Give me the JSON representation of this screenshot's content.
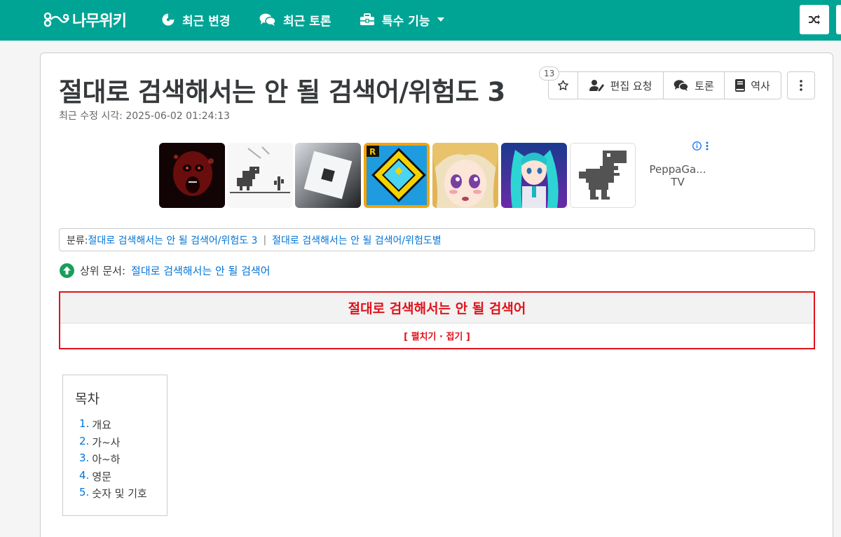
{
  "nav": {
    "logo_text": "나무위키",
    "items": [
      {
        "label": "최근 변경",
        "icon": "compass-icon"
      },
      {
        "label": "최근 토론",
        "icon": "comments-icon"
      },
      {
        "label": "특수 기능",
        "icon": "toolbox-icon"
      }
    ],
    "brand_color": "#00a495"
  },
  "page": {
    "title": "절대로 검색해서는 안 될 검색어/위험도 3",
    "modified": "최근 수정 시각: 2025-06-02 01:24:13",
    "star_count": "13",
    "actions": {
      "edit_request": "편집 요청",
      "discuss": "토론",
      "history": "역사"
    }
  },
  "ad": {
    "label": "PeppaGa... TV",
    "thumbnails": [
      "red-face-thumbnail",
      "dino-game-thumbnail",
      "roblox-logo-thumbnail",
      "geometry-dash-thumbnail",
      "anime-girl-thumbnail",
      "vocaloid-thumbnail",
      "dino-pixel-thumbnail"
    ]
  },
  "category": {
    "label": "분류:",
    "items": [
      "절대로 검색해서는 안 될 검색어/위험도 3",
      "절대로 검색해서는 안 될 검색어/위험도별"
    ]
  },
  "parent_doc": {
    "label": "상위 문서:",
    "link": "절대로 검색해서는 안 될 검색어"
  },
  "navbox": {
    "title": "절대로 검색해서는 안 될 검색어",
    "toggle": "[ 펼치기 · 접기 ]",
    "accent": "#e0121b"
  },
  "toc": {
    "title": "목차",
    "items": [
      {
        "num": "1.",
        "text": "개요"
      },
      {
        "num": "2.",
        "text": "가~사"
      },
      {
        "num": "3.",
        "text": "아~하"
      },
      {
        "num": "4.",
        "text": "영문"
      },
      {
        "num": "5.",
        "text": "숫자 및 기호"
      }
    ]
  }
}
